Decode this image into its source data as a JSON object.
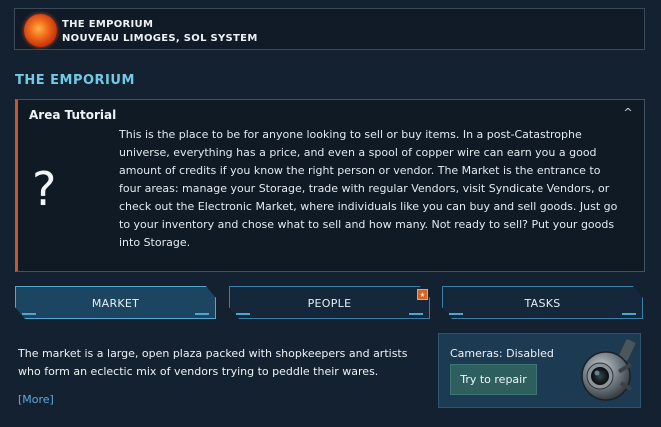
{
  "header": {
    "title": "THE EMPORIUM",
    "subtitle": "NOUVEAU LIMOGES, SOL SYSTEM",
    "icon": "sun-icon"
  },
  "page_title": "THE EMPORIUM",
  "tutorial": {
    "title": "Area Tutorial",
    "collapse_icon": "^",
    "icon": "?",
    "body": "This is the place to be for anyone looking to sell or buy items. In a post-Catastrophe universe, everything has a price, and even a spool of copper wire can earn you a good amount of credits if you know the right person or vendor. The Market is the entrance to four areas: manage your Storage, trade with regular Vendors, visit Syndicate Vendors, or check out the Electronic Market, where individuals like you can buy and sell goods. Just go to your inventory and chose what to sell and how many. Not ready to sell? Put your goods into Storage."
  },
  "tabs": [
    {
      "label": "MARKET",
      "active": true
    },
    {
      "label": "PEOPLE",
      "active": false,
      "notification": "star-icon"
    },
    {
      "label": "TASKS",
      "active": false
    }
  ],
  "description": "The market is a large, open plaza packed with shopkeepers and artists who form an eclectic mix of vendors trying to peddle their wares.",
  "more_link": "[More]",
  "camera": {
    "status": "Cameras: Disabled",
    "button": "Try to repair",
    "icon": "security-camera-icon"
  },
  "colors": {
    "background": "#142130",
    "accent_title": "#71cbe6",
    "tutorial_border": "#c15a32",
    "tab_active": "#1b4560",
    "repair_button": "#2e5f5e"
  }
}
